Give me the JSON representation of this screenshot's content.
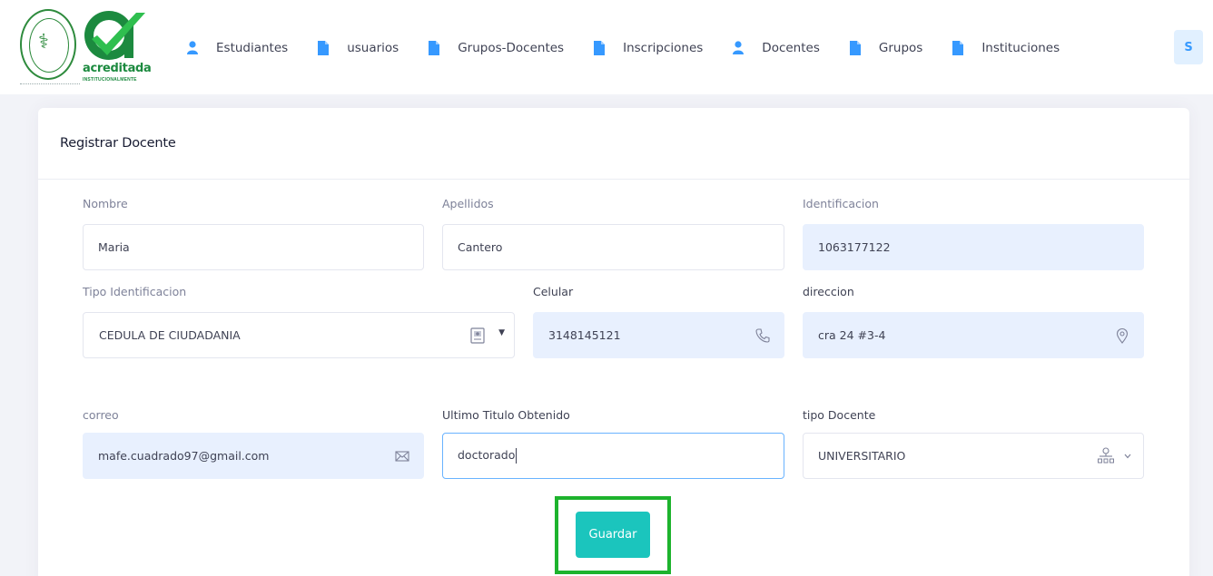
{
  "header": {
    "brand": {
      "accreditation_text": "acreditada",
      "accreditation_sub": "INSTITUCIONALMENTE"
    },
    "nav": [
      {
        "label": "Estudiantes",
        "icon": "user-icon"
      },
      {
        "label": "usuarios",
        "icon": "file-icon"
      },
      {
        "label": "Grupos-Docentes",
        "icon": "file-icon"
      },
      {
        "label": "Inscripciones",
        "icon": "file-icon"
      },
      {
        "label": "Docentes",
        "icon": "user-icon"
      },
      {
        "label": "Grupos",
        "icon": "file-icon"
      },
      {
        "label": "Instituciones",
        "icon": "file-icon"
      }
    ],
    "user_initial": "S"
  },
  "form": {
    "title": "Registrar Docente",
    "nombre": {
      "label": "Nombre",
      "value": "Maria"
    },
    "apellidos": {
      "label": "Apellidos",
      "value": "Cantero"
    },
    "identificacion": {
      "label": "Identificacion",
      "value": "1063177122"
    },
    "tipo_identificacion": {
      "label": "Tipo Identificacion",
      "value": "CEDULA DE CIUDADANIA"
    },
    "celular": {
      "label": "Celular",
      "value": "3148145121"
    },
    "direccion": {
      "label": "direccion",
      "value": "cra 24 #3-4"
    },
    "correo": {
      "label": "correo",
      "value": "mafe.cuadrado97@gmail.com"
    },
    "ultimo_titulo": {
      "label": "Ultimo Titulo Obtenido",
      "value": "doctorado"
    },
    "tipo_docente": {
      "label": "tipo Docente",
      "value": "UNIVERSITARIO"
    },
    "save_label": "Guardar"
  },
  "colors": {
    "accent": "#1bc5bd",
    "highlight": "#1db32d",
    "autofill_bg": "#e8f0fe",
    "nav_icon": "#3699ff"
  }
}
